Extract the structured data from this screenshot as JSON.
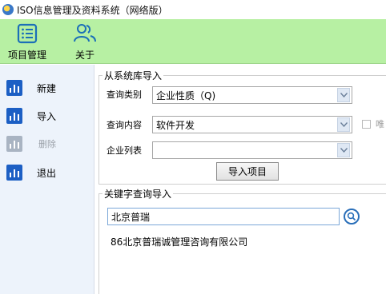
{
  "window": {
    "title": "ISO信息管理及资料系统（网络版）"
  },
  "ribbon": {
    "project_label": "项目管理",
    "about_label": "关于",
    "color": "#b7f0a3"
  },
  "sidebar": {
    "items": [
      {
        "label": "新建",
        "enabled": true
      },
      {
        "label": "导入",
        "enabled": true
      },
      {
        "label": "删除",
        "enabled": false
      },
      {
        "label": "退出",
        "enabled": true
      }
    ]
  },
  "system_import": {
    "legend": "从系统库导入",
    "query_type_label": "查询类别",
    "query_type_value": "企业性质（Q)",
    "query_content_label": "查询内容",
    "query_content_value": "软件开发",
    "company_list_label": "企业列表",
    "company_list_value": "",
    "checkbox_label": "唯",
    "import_button": "导入项目"
  },
  "keyword_import": {
    "legend": "关键字查询导入",
    "search_value": "北京普瑞",
    "results": [
      "86北京普瑞诚管理咨询有限公司"
    ]
  }
}
